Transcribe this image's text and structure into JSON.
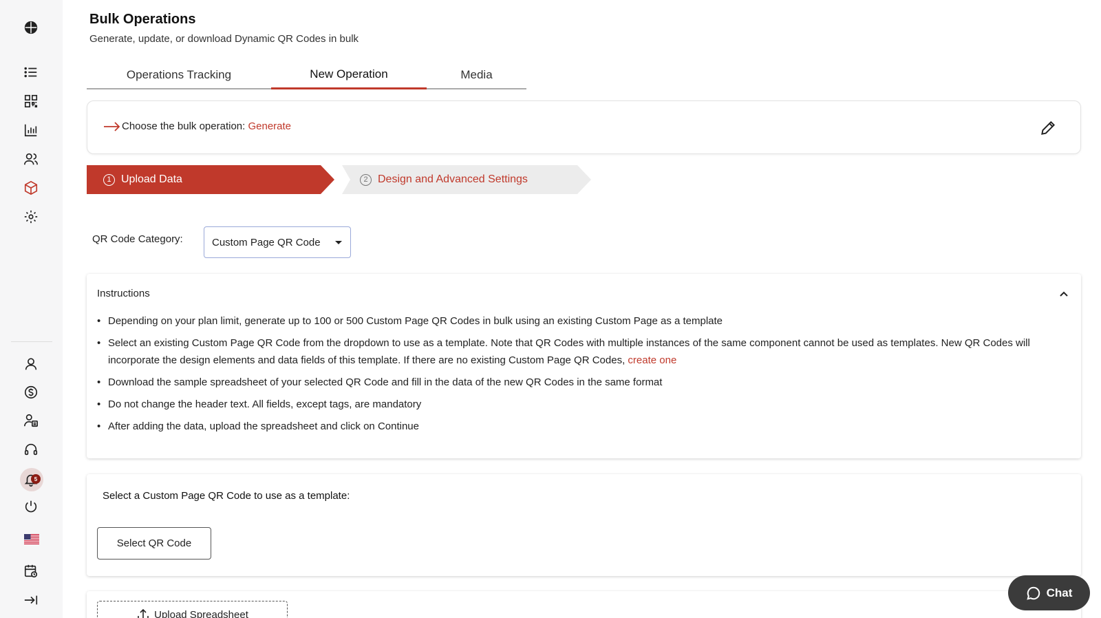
{
  "header": {
    "title": "Bulk Operations",
    "subtitle": "Generate, update, or download Dynamic QR Codes in bulk"
  },
  "tabs": [
    {
      "label": "Operations Tracking",
      "active": false
    },
    {
      "label": "New Operation",
      "active": true
    },
    {
      "label": "Media",
      "active": false
    }
  ],
  "operation": {
    "prefix": "Choose the bulk operation: ",
    "value": "Generate"
  },
  "steps": [
    {
      "number": "1",
      "label": "Upload Data",
      "active": true
    },
    {
      "number": "2",
      "label": "Design and Advanced Settings",
      "active": false
    }
  ],
  "category": {
    "label": "QR Code Category:",
    "selected": "Custom Page QR Code"
  },
  "instructions": {
    "title": "Instructions",
    "items": [
      "Depending on your plan limit, generate up to 100 or 500 Custom Page QR Codes in bulk using an existing Custom Page as a template",
      "Select an existing Custom Page QR Code from the dropdown to use as a template. Note that QR Codes with multiple instances of the same component cannot be used as templates. New QR Codes will incorporate the design elements and data fields of this template. If there are no existing Custom Page QR Codes, ",
      "Download the sample spreadsheet of your selected QR Code and fill in the data of the new QR Codes in the same format",
      "Do not change the header text. All fields, except tags, are mandatory",
      "After adding the data, upload the spreadsheet and click on Continue"
    ],
    "link_text": "create one"
  },
  "template": {
    "label": "Select a Custom Page QR Code to use as a template:",
    "button": "Select QR Code"
  },
  "upload": {
    "button": "Upload Spreadsheet"
  },
  "chat": {
    "label": "Chat"
  },
  "notifications": {
    "count": "5"
  },
  "colors": {
    "accent": "#c0392b",
    "sidebar_bg": "#f6f6f7",
    "chat_bg": "#3b3b3b"
  },
  "sidebar_icons": [
    "globe-icon",
    "list-icon",
    "qr-code-icon",
    "analytics-icon",
    "users-icon",
    "cube-icon",
    "gear-icon",
    "user-icon",
    "billing-icon",
    "user-settings-icon",
    "headset-icon",
    "bell-icon",
    "power-icon",
    "us-flag-icon",
    "calendar-icon",
    "collapse-icon"
  ]
}
